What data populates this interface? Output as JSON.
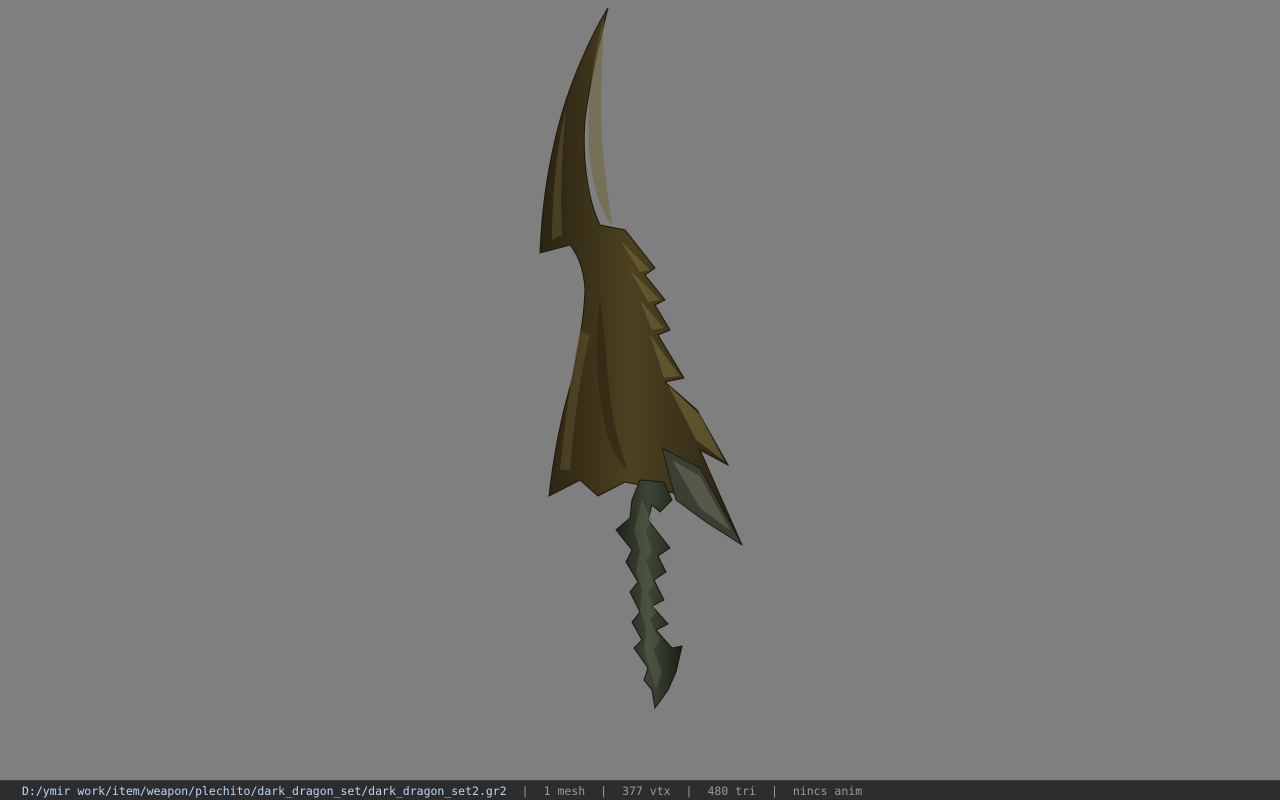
{
  "viewer": {
    "background_color": "#7f7f7f",
    "model_name": "dark_dragon_set2",
    "model_colors": {
      "blade_dark": "#2f2616",
      "blade_mid": "#4c4120",
      "blade_highlight": "#6f6535",
      "hilt_dark": "#252a1e",
      "hilt_mid": "#3b4233"
    }
  },
  "status_bar": {
    "background_color": "#2b2d2f",
    "path_color": "#b9d6f2",
    "file_path": "D:/ymir work/item/weapon/plechito/dark_dragon_set/dark_dragon_set2.gr2",
    "separator": "|",
    "mesh_count": "1 mesh",
    "vertex_count": "377 vtx",
    "triangle_count": "480 tri",
    "anim_status": "nincs anim"
  }
}
